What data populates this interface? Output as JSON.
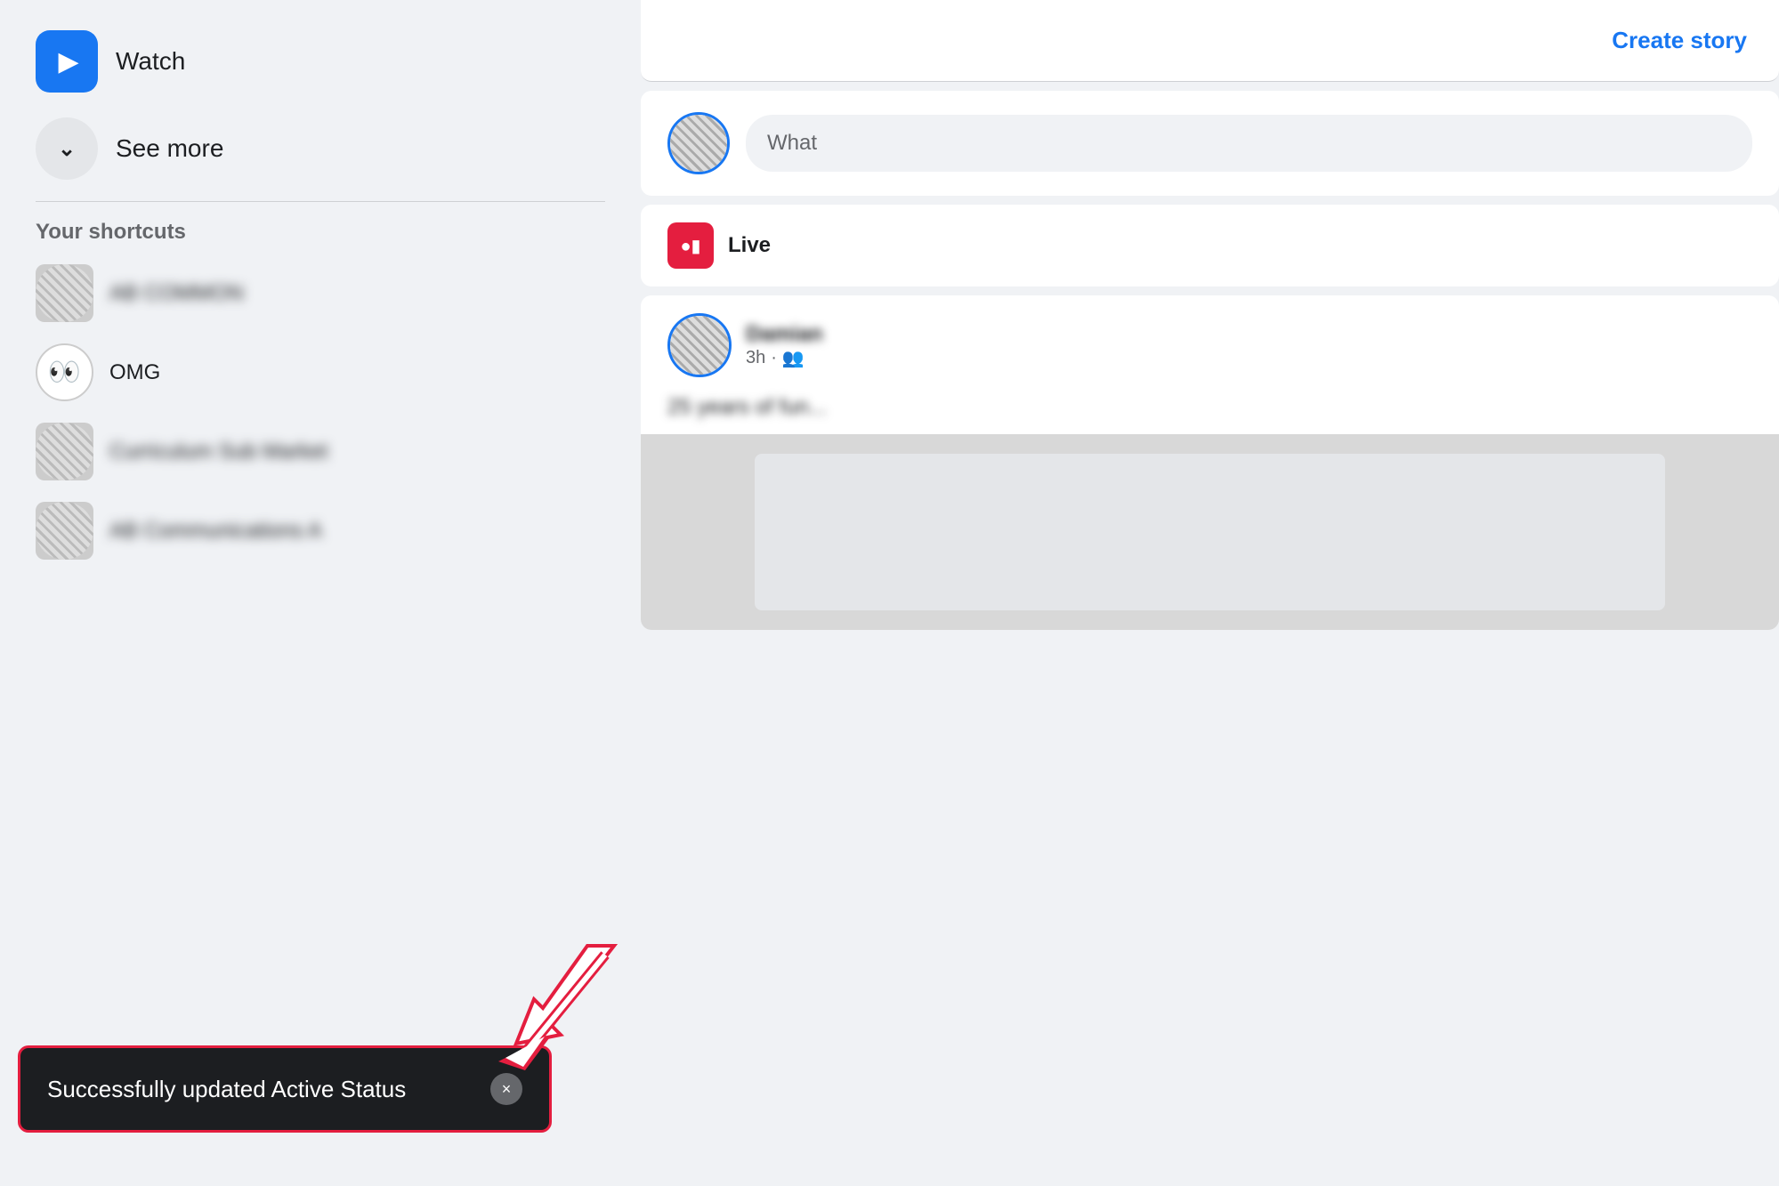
{
  "leftSidebar": {
    "watchLabel": "Watch",
    "seeMoreLabel": "See more",
    "shortcutsTitle": "Your shortcuts",
    "shortcuts": [
      {
        "id": "sc1",
        "name": "AB COMMON",
        "blurred": true
      },
      {
        "id": "sc2",
        "name": "OMG",
        "blurred": false,
        "isEmoji": true
      },
      {
        "id": "sc3",
        "name": "Curriculum Sub Market",
        "blurred": true
      },
      {
        "id": "sc4",
        "name": "AB Communications A",
        "blurred": true
      }
    ]
  },
  "rightPanel": {
    "createStoryLabel": "Create story",
    "postInputPlaceholder": "What",
    "liveLabel": "Live",
    "feedPost": {
      "name": "Damian",
      "time": "3h",
      "audienceIcon": "friends-icon",
      "body": "25 years of fun..."
    }
  },
  "toast": {
    "message": "Successfully updated Active Status",
    "closeLabel": "×"
  }
}
